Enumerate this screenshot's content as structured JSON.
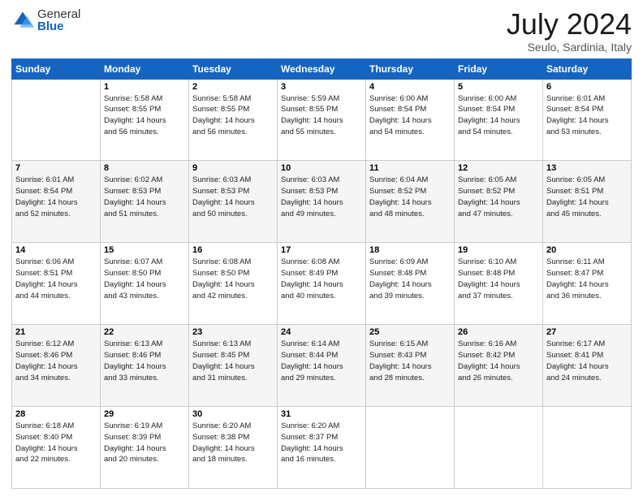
{
  "header": {
    "logo_general": "General",
    "logo_blue": "Blue",
    "month_year": "July 2024",
    "location": "Seulo, Sardinia, Italy"
  },
  "calendar": {
    "days_of_week": [
      "Sunday",
      "Monday",
      "Tuesday",
      "Wednesday",
      "Thursday",
      "Friday",
      "Saturday"
    ],
    "weeks": [
      [
        {
          "day": "",
          "info": ""
        },
        {
          "day": "1",
          "info": "Sunrise: 5:58 AM\nSunset: 8:55 PM\nDaylight: 14 hours\nand 56 minutes."
        },
        {
          "day": "2",
          "info": "Sunrise: 5:58 AM\nSunset: 8:55 PM\nDaylight: 14 hours\nand 56 minutes."
        },
        {
          "day": "3",
          "info": "Sunrise: 5:59 AM\nSunset: 8:55 PM\nDaylight: 14 hours\nand 55 minutes."
        },
        {
          "day": "4",
          "info": "Sunrise: 6:00 AM\nSunset: 8:54 PM\nDaylight: 14 hours\nand 54 minutes."
        },
        {
          "day": "5",
          "info": "Sunrise: 6:00 AM\nSunset: 8:54 PM\nDaylight: 14 hours\nand 54 minutes."
        },
        {
          "day": "6",
          "info": "Sunrise: 6:01 AM\nSunset: 8:54 PM\nDaylight: 14 hours\nand 53 minutes."
        }
      ],
      [
        {
          "day": "7",
          "info": "Sunrise: 6:01 AM\nSunset: 8:54 PM\nDaylight: 14 hours\nand 52 minutes."
        },
        {
          "day": "8",
          "info": "Sunrise: 6:02 AM\nSunset: 8:53 PM\nDaylight: 14 hours\nand 51 minutes."
        },
        {
          "day": "9",
          "info": "Sunrise: 6:03 AM\nSunset: 8:53 PM\nDaylight: 14 hours\nand 50 minutes."
        },
        {
          "day": "10",
          "info": "Sunrise: 6:03 AM\nSunset: 8:53 PM\nDaylight: 14 hours\nand 49 minutes."
        },
        {
          "day": "11",
          "info": "Sunrise: 6:04 AM\nSunset: 8:52 PM\nDaylight: 14 hours\nand 48 minutes."
        },
        {
          "day": "12",
          "info": "Sunrise: 6:05 AM\nSunset: 8:52 PM\nDaylight: 14 hours\nand 47 minutes."
        },
        {
          "day": "13",
          "info": "Sunrise: 6:05 AM\nSunset: 8:51 PM\nDaylight: 14 hours\nand 45 minutes."
        }
      ],
      [
        {
          "day": "14",
          "info": "Sunrise: 6:06 AM\nSunset: 8:51 PM\nDaylight: 14 hours\nand 44 minutes."
        },
        {
          "day": "15",
          "info": "Sunrise: 6:07 AM\nSunset: 8:50 PM\nDaylight: 14 hours\nand 43 minutes."
        },
        {
          "day": "16",
          "info": "Sunrise: 6:08 AM\nSunset: 8:50 PM\nDaylight: 14 hours\nand 42 minutes."
        },
        {
          "day": "17",
          "info": "Sunrise: 6:08 AM\nSunset: 8:49 PM\nDaylight: 14 hours\nand 40 minutes."
        },
        {
          "day": "18",
          "info": "Sunrise: 6:09 AM\nSunset: 8:48 PM\nDaylight: 14 hours\nand 39 minutes."
        },
        {
          "day": "19",
          "info": "Sunrise: 6:10 AM\nSunset: 8:48 PM\nDaylight: 14 hours\nand 37 minutes."
        },
        {
          "day": "20",
          "info": "Sunrise: 6:11 AM\nSunset: 8:47 PM\nDaylight: 14 hours\nand 36 minutes."
        }
      ],
      [
        {
          "day": "21",
          "info": "Sunrise: 6:12 AM\nSunset: 8:46 PM\nDaylight: 14 hours\nand 34 minutes."
        },
        {
          "day": "22",
          "info": "Sunrise: 6:13 AM\nSunset: 8:46 PM\nDaylight: 14 hours\nand 33 minutes."
        },
        {
          "day": "23",
          "info": "Sunrise: 6:13 AM\nSunset: 8:45 PM\nDaylight: 14 hours\nand 31 minutes."
        },
        {
          "day": "24",
          "info": "Sunrise: 6:14 AM\nSunset: 8:44 PM\nDaylight: 14 hours\nand 29 minutes."
        },
        {
          "day": "25",
          "info": "Sunrise: 6:15 AM\nSunset: 8:43 PM\nDaylight: 14 hours\nand 28 minutes."
        },
        {
          "day": "26",
          "info": "Sunrise: 6:16 AM\nSunset: 8:42 PM\nDaylight: 14 hours\nand 26 minutes."
        },
        {
          "day": "27",
          "info": "Sunrise: 6:17 AM\nSunset: 8:41 PM\nDaylight: 14 hours\nand 24 minutes."
        }
      ],
      [
        {
          "day": "28",
          "info": "Sunrise: 6:18 AM\nSunset: 8:40 PM\nDaylight: 14 hours\nand 22 minutes."
        },
        {
          "day": "29",
          "info": "Sunrise: 6:19 AM\nSunset: 8:39 PM\nDaylight: 14 hours\nand 20 minutes."
        },
        {
          "day": "30",
          "info": "Sunrise: 6:20 AM\nSunset: 8:38 PM\nDaylight: 14 hours\nand 18 minutes."
        },
        {
          "day": "31",
          "info": "Sunrise: 6:20 AM\nSunset: 8:37 PM\nDaylight: 14 hours\nand 16 minutes."
        },
        {
          "day": "",
          "info": ""
        },
        {
          "day": "",
          "info": ""
        },
        {
          "day": "",
          "info": ""
        }
      ]
    ]
  }
}
